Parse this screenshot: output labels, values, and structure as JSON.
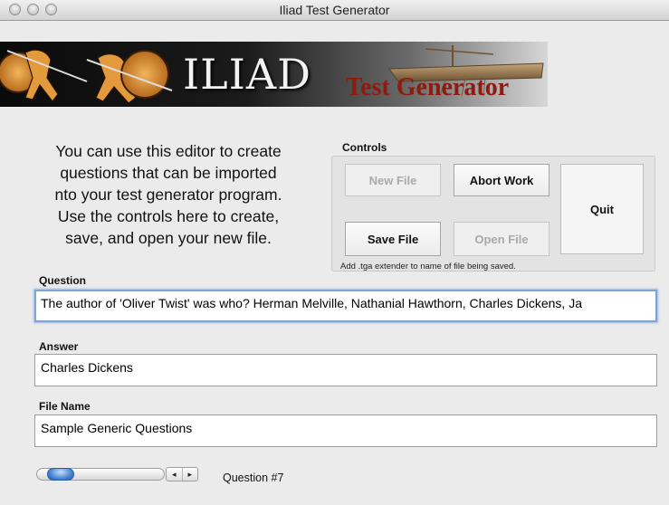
{
  "window": {
    "title": "Iliad Test Generator"
  },
  "banner": {
    "brand": "ILIAD",
    "subtitle": "Test Generator"
  },
  "intro": {
    "lines": [
      "You can use this editor to create",
      "questions that can be imported",
      "nto your test generator program.",
      "Use the controls here to create,",
      "save, and open your new file."
    ]
  },
  "controls": {
    "label": "Controls",
    "new_file": "New File",
    "abort_work": "Abort Work",
    "quit": "Quit",
    "save_file": "Save File",
    "open_file": "Open File",
    "hint": "Add .tga extender to name of file being saved."
  },
  "question": {
    "label": "Question",
    "value": "The author of 'Oliver Twist' was who? Herman Melville, Nathanial Hawthorn, Charles Dickens, Ja"
  },
  "answer": {
    "label": "Answer",
    "value": "Charles Dickens"
  },
  "file_name": {
    "label": "File Name",
    "value": "Sample Generic Questions"
  },
  "navigator": {
    "slider_position": 0.1,
    "prev_icon": "◂",
    "next_icon": "▸",
    "question_counter": "Question #7"
  },
  "colors": {
    "accent": "#3f7ed2",
    "banner_title": "#8e1b10"
  }
}
